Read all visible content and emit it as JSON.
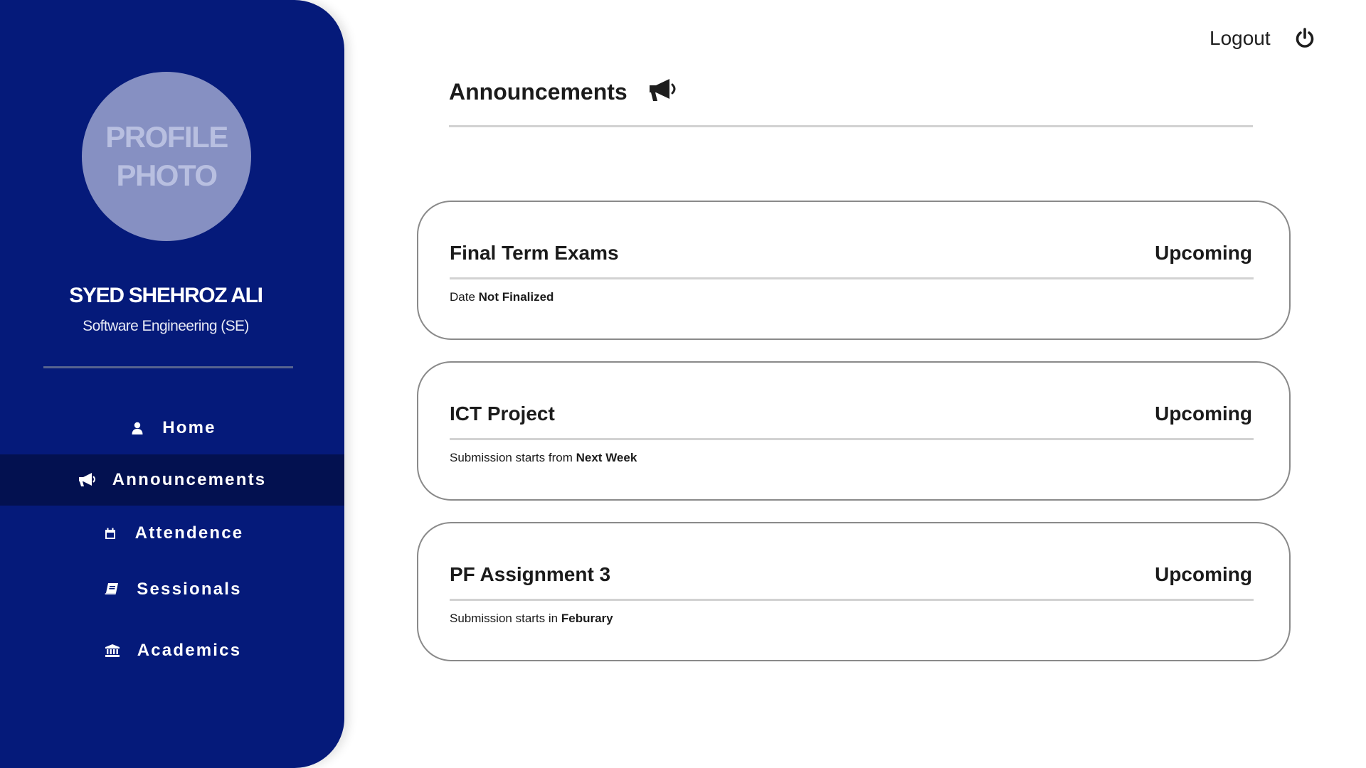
{
  "profile": {
    "photo_placeholder": "PROFILE PHOTO",
    "name": "SYED SHEHROZ ALI",
    "program": "Software Engineering (SE)"
  },
  "sidebar": {
    "items": [
      {
        "label": "Home",
        "icon": "user-icon",
        "active": false
      },
      {
        "label": "Announcements",
        "icon": "megaphone-icon",
        "active": true
      },
      {
        "label": "Attendence",
        "icon": "calendar-icon",
        "active": false
      },
      {
        "label": "Sessionals",
        "icon": "book-icon",
        "active": false
      },
      {
        "label": "Academics",
        "icon": "institution-icon",
        "active": false
      }
    ]
  },
  "header": {
    "logout_label": "Logout",
    "logout_icon": "power-icon",
    "title": "Announcements",
    "title_icon": "megaphone-icon"
  },
  "announcements": [
    {
      "title": "Final Term Exams",
      "status": "Upcoming",
      "detail_prefix": "Date",
      "detail_value": "Not Finalized"
    },
    {
      "title": "ICT Project",
      "status": "Upcoming",
      "detail_prefix": "Submission starts from",
      "detail_value": "Next Week"
    },
    {
      "title": "PF Assignment 3",
      "status": "Upcoming",
      "detail_prefix": "Submission starts in",
      "detail_value": "Feburary"
    }
  ],
  "colors": {
    "sidebar": "#051a7a",
    "sidebar_active": "#031150",
    "avatar": "#8690c2",
    "card_border": "#8a8a8a",
    "divider": "#d2d2d2"
  }
}
